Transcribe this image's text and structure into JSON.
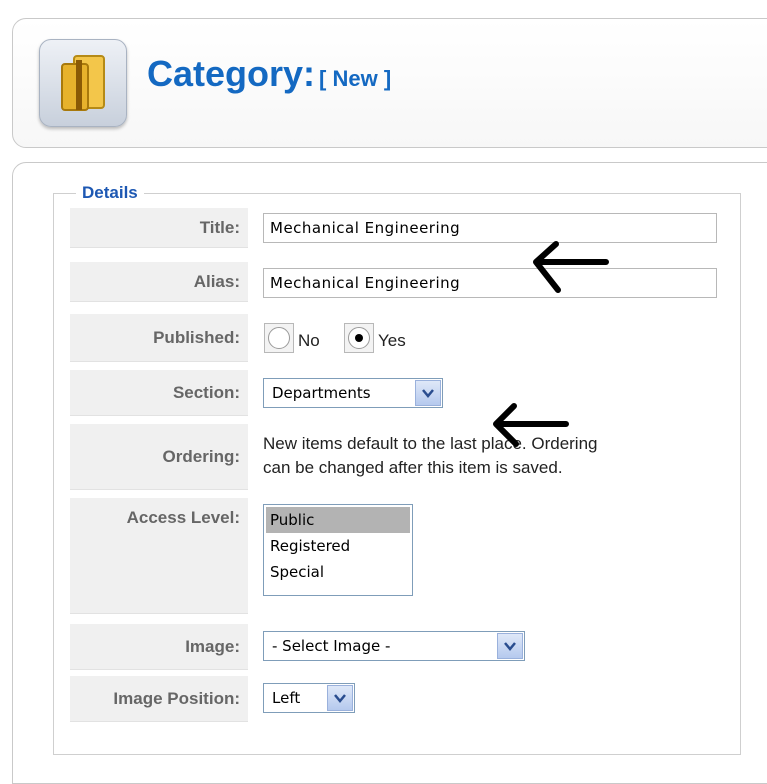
{
  "header": {
    "title": "Category:",
    "subtitle": "[ New ]"
  },
  "details": {
    "legend": "Details",
    "title_label": "Title:",
    "title_value": "Mechanical Engineering",
    "alias_label": "Alias:",
    "alias_value": "Mechanical Engineering",
    "published_label": "Published:",
    "published_no": "No",
    "published_yes": "Yes",
    "published_selected": "Yes",
    "section_label": "Section:",
    "section_value": "Departments",
    "ordering_label": "Ordering:",
    "ordering_note_line1": "New items default to the last place. Ordering",
    "ordering_note_line2": "can be changed after this item is saved.",
    "access_label": "Access Level:",
    "access_options": [
      "Public",
      "Registered",
      "Special"
    ],
    "access_selected": "Public",
    "image_label": "Image:",
    "image_value": "- Select Image -",
    "image_position_label": "Image Position:",
    "image_position_value": "Left"
  },
  "colors": {
    "title_blue": "#1469c2",
    "legend_blue": "#1d58b3",
    "label_bg": "#f0f0f0"
  },
  "icons": [
    "category-folder-icon",
    "arrow-left-icon",
    "dropdown-arrow-icon"
  ]
}
